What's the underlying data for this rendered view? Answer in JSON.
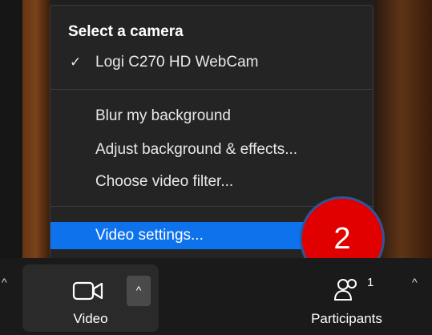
{
  "menu": {
    "heading": "Select a camera",
    "camera_item": {
      "label": "Logi C270 HD WebCam",
      "checked": true,
      "check_glyph": "✓"
    },
    "items": [
      {
        "label": "Blur my background"
      },
      {
        "label": "Adjust background & effects..."
      },
      {
        "label": "Choose video filter..."
      }
    ],
    "settings_item": {
      "label": "Video settings...",
      "highlighted": true
    }
  },
  "badge": {
    "text": "2",
    "fill": "#e00000",
    "ring": "#2f5597"
  },
  "toolbar": {
    "video_label": "Video",
    "video_icon": "video-camera-icon",
    "caret_glyph": "^",
    "participants_label": "Participants",
    "participants_icon": "participants-icon",
    "participants_count": "1"
  },
  "colors": {
    "highlight": "#0e72ed",
    "menu_bg": "#242424"
  }
}
